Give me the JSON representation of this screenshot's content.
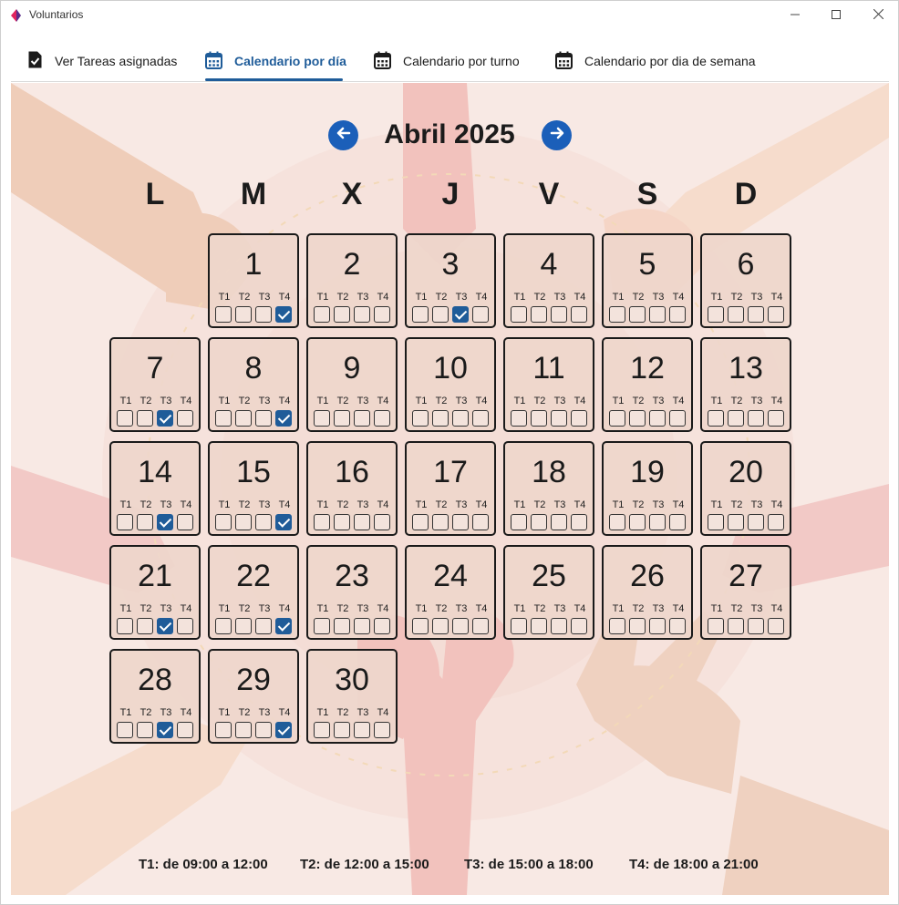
{
  "window": {
    "title": "Voluntarios"
  },
  "tabs": [
    {
      "label": "Ver Tareas asignadas",
      "icon": "clipboard-check-icon",
      "active": false
    },
    {
      "label": "Calendario por día",
      "icon": "calendar-icon",
      "active": true
    },
    {
      "label": "Calendario por turno",
      "icon": "calendar-icon",
      "active": false
    },
    {
      "label": "Calendario por dia de semana",
      "icon": "calendar-icon",
      "active": false
    }
  ],
  "calendar": {
    "month_title": "Abril 2025",
    "weekdays": [
      "L",
      "M",
      "X",
      "J",
      "V",
      "S",
      "D"
    ],
    "shift_labels": [
      "T1",
      "T2",
      "T3",
      "T4"
    ],
    "days": [
      {
        "day": "1",
        "checked": [
          false,
          false,
          false,
          true
        ]
      },
      {
        "day": "2",
        "checked": [
          false,
          false,
          false,
          false
        ]
      },
      {
        "day": "3",
        "checked": [
          false,
          false,
          true,
          false
        ]
      },
      {
        "day": "4",
        "checked": [
          false,
          false,
          false,
          false
        ]
      },
      {
        "day": "5",
        "checked": [
          false,
          false,
          false,
          false
        ]
      },
      {
        "day": "6",
        "checked": [
          false,
          false,
          false,
          false
        ]
      },
      {
        "day": "7",
        "checked": [
          false,
          false,
          true,
          false
        ]
      },
      {
        "day": "8",
        "checked": [
          false,
          false,
          false,
          true
        ]
      },
      {
        "day": "9",
        "checked": [
          false,
          false,
          false,
          false
        ]
      },
      {
        "day": "10",
        "checked": [
          false,
          false,
          false,
          false
        ]
      },
      {
        "day": "11",
        "checked": [
          false,
          false,
          false,
          false
        ]
      },
      {
        "day": "12",
        "checked": [
          false,
          false,
          false,
          false
        ]
      },
      {
        "day": "13",
        "checked": [
          false,
          false,
          false,
          false
        ]
      },
      {
        "day": "14",
        "checked": [
          false,
          false,
          true,
          false
        ]
      },
      {
        "day": "15",
        "checked": [
          false,
          false,
          false,
          true
        ]
      },
      {
        "day": "16",
        "checked": [
          false,
          false,
          false,
          false
        ]
      },
      {
        "day": "17",
        "checked": [
          false,
          false,
          false,
          false
        ]
      },
      {
        "day": "18",
        "checked": [
          false,
          false,
          false,
          false
        ]
      },
      {
        "day": "19",
        "checked": [
          false,
          false,
          false,
          false
        ]
      },
      {
        "day": "20",
        "checked": [
          false,
          false,
          false,
          false
        ]
      },
      {
        "day": "21",
        "checked": [
          false,
          false,
          true,
          false
        ]
      },
      {
        "day": "22",
        "checked": [
          false,
          false,
          false,
          true
        ]
      },
      {
        "day": "23",
        "checked": [
          false,
          false,
          false,
          false
        ]
      },
      {
        "day": "24",
        "checked": [
          false,
          false,
          false,
          false
        ]
      },
      {
        "day": "25",
        "checked": [
          false,
          false,
          false,
          false
        ]
      },
      {
        "day": "26",
        "checked": [
          false,
          false,
          false,
          false
        ]
      },
      {
        "day": "27",
        "checked": [
          false,
          false,
          false,
          false
        ]
      },
      {
        "day": "28",
        "checked": [
          false,
          false,
          true,
          false
        ]
      },
      {
        "day": "29",
        "checked": [
          false,
          false,
          false,
          true
        ]
      },
      {
        "day": "30",
        "checked": [
          false,
          false,
          false,
          false
        ]
      }
    ]
  },
  "legend": [
    "T1: de 09:00 a 12:00",
    "T2: de 12:00 a 15:00",
    "T3: de 15:00 a 18:00",
    "T4: de 18:00 a 21:00"
  ],
  "colors": {
    "accent": "#1f5c99",
    "nav_button": "#1b5fb9",
    "cell_background": "#eed6cb",
    "app_icon_left": "#e0245e",
    "app_icon_right": "#5a2b8a"
  }
}
